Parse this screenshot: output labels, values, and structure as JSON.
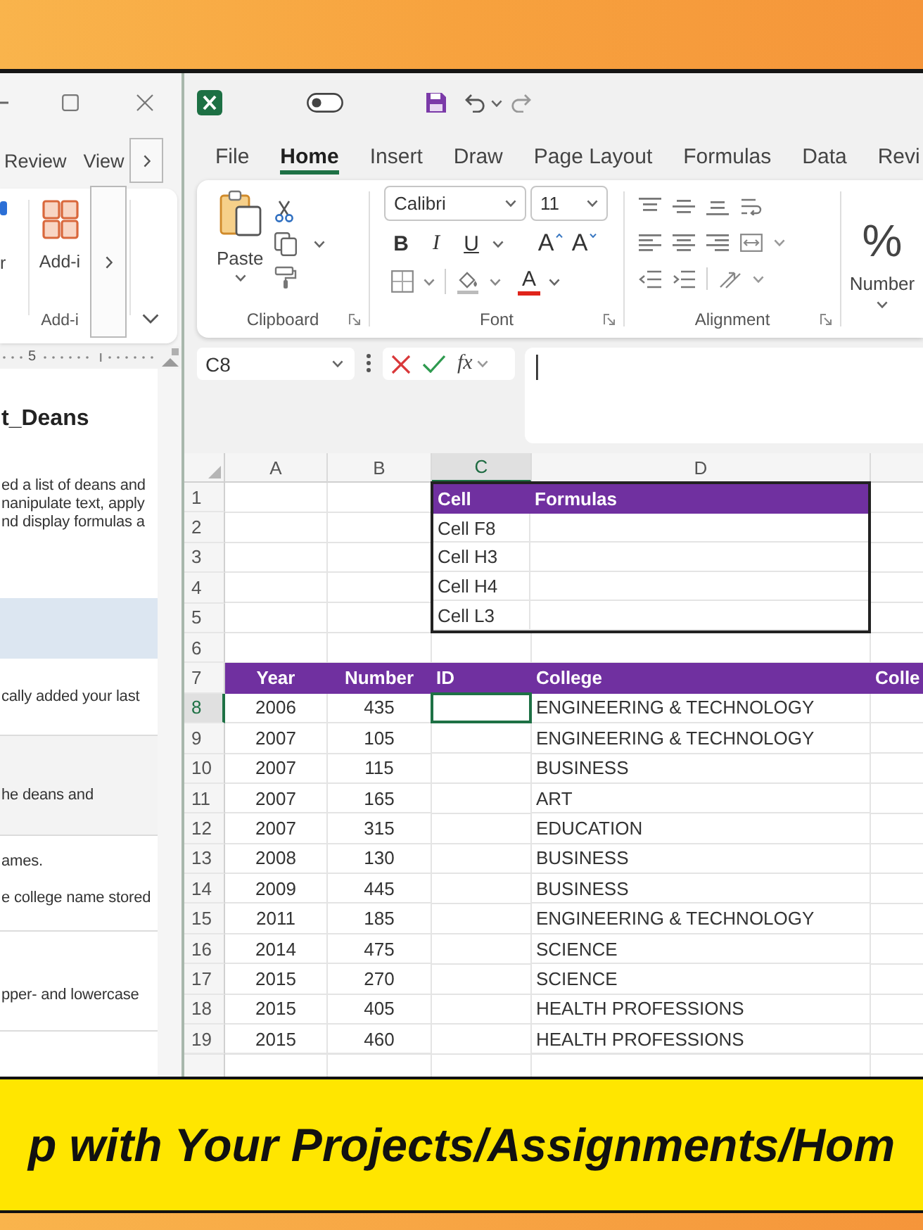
{
  "doc_pane": {
    "tabs": [
      "Review",
      "View"
    ],
    "ribbon": {
      "buttons": [
        {
          "kind": "cut_off",
          "label": "r"
        },
        {
          "kind": "add_ins",
          "label": "Add-i"
        }
      ],
      "group_label": "Add-i"
    },
    "ruler_number": "5",
    "heading": "t_Deans",
    "paragraph_lines": [
      "ed a list of deans and",
      "nanipulate text, apply",
      "nd display formulas a"
    ],
    "steps": [
      {
        "kind": "highlighted"
      },
      {
        "kind": "plain",
        "lines": [
          "cally added your last"
        ]
      },
      {
        "kind": "shaded",
        "lines": [
          "he deans and"
        ]
      },
      {
        "kind": "plain",
        "lines": [
          "ames.",
          "e college name stored"
        ]
      },
      {
        "kind": "plain",
        "lines": [
          "pper- and lowercase"
        ]
      }
    ]
  },
  "excel": {
    "menu_tabs": [
      {
        "label": "File",
        "selected": false
      },
      {
        "label": "Home",
        "selected": true
      },
      {
        "label": "Insert",
        "selected": false
      },
      {
        "label": "Draw",
        "selected": false
      },
      {
        "label": "Page Layout",
        "selected": false
      },
      {
        "label": "Formulas",
        "selected": false
      },
      {
        "label": "Data",
        "selected": false
      },
      {
        "label": "Revi",
        "selected": false
      }
    ],
    "ribbon_groups": [
      {
        "kind": "clipboard",
        "label": "Clipboard",
        "paste_label": "Paste"
      },
      {
        "kind": "font",
        "label": "Font",
        "font_name": "Calibri",
        "font_size": "11",
        "bold": "B",
        "italic": "I",
        "underline": "U",
        "grow_font": "A",
        "shrink_font": "A",
        "font_color": "A"
      },
      {
        "kind": "alignment",
        "label": "Alignment"
      },
      {
        "kind": "number",
        "label": "Number",
        "symbol": "%"
      }
    ],
    "formula_bar": {
      "name_box": "C8",
      "function_label": "fx"
    },
    "sheet": {
      "columns": [
        {
          "label": "A",
          "selected": false
        },
        {
          "label": "B",
          "selected": false
        },
        {
          "label": "C",
          "selected": true
        },
        {
          "label": "D",
          "selected": false
        }
      ],
      "row_numbers": [
        {
          "label": "1",
          "selected": false
        },
        {
          "label": "2",
          "selected": false
        },
        {
          "label": "3",
          "selected": false
        },
        {
          "label": "4",
          "selected": false
        },
        {
          "label": "5",
          "selected": false
        },
        {
          "label": "6",
          "selected": false
        },
        {
          "label": "7",
          "selected": false
        },
        {
          "label": "8",
          "selected": true
        },
        {
          "label": "9",
          "selected": false
        },
        {
          "label": "10",
          "selected": false
        },
        {
          "label": "11",
          "selected": false
        },
        {
          "label": "12",
          "selected": false
        },
        {
          "label": "13",
          "selected": false
        },
        {
          "label": "14",
          "selected": false
        },
        {
          "label": "15",
          "selected": false
        },
        {
          "label": "16",
          "selected": false
        },
        {
          "label": "17",
          "selected": false
        },
        {
          "label": "18",
          "selected": false
        },
        {
          "label": "19",
          "selected": false
        }
      ],
      "lookup_table": {
        "headers": [
          "Cell",
          "Formulas"
        ],
        "rows": [
          "Cell F8",
          "Cell H3",
          "Cell H4",
          "Cell L3"
        ]
      },
      "data_table": {
        "headers": [
          "Year",
          "Number",
          "ID",
          "College",
          "Colle"
        ],
        "rows": [
          {
            "year": "2006",
            "number": "435",
            "college": "ENGINEERING & TECHNOLOGY"
          },
          {
            "year": "2007",
            "number": "105",
            "college": "ENGINEERING & TECHNOLOGY"
          },
          {
            "year": "2007",
            "number": "115",
            "college": "BUSINESS"
          },
          {
            "year": "2007",
            "number": "165",
            "college": "ART"
          },
          {
            "year": "2007",
            "number": "315",
            "college": "EDUCATION"
          },
          {
            "year": "2008",
            "number": "130",
            "college": "BUSINESS"
          },
          {
            "year": "2009",
            "number": "445",
            "college": "BUSINESS"
          },
          {
            "year": "2011",
            "number": "185",
            "college": "ENGINEERING & TECHNOLOGY"
          },
          {
            "year": "2014",
            "number": "475",
            "college": "SCIENCE"
          },
          {
            "year": "2015",
            "number": "270",
            "college": "SCIENCE"
          },
          {
            "year": "2015",
            "number": "405",
            "college": "HEALTH PROFESSIONS"
          },
          {
            "year": "2015",
            "number": "460",
            "college": "HEALTH PROFESSIONS"
          }
        ]
      }
    }
  },
  "banner": {
    "text": "p with Your Projects/Assignments/Hom"
  }
}
